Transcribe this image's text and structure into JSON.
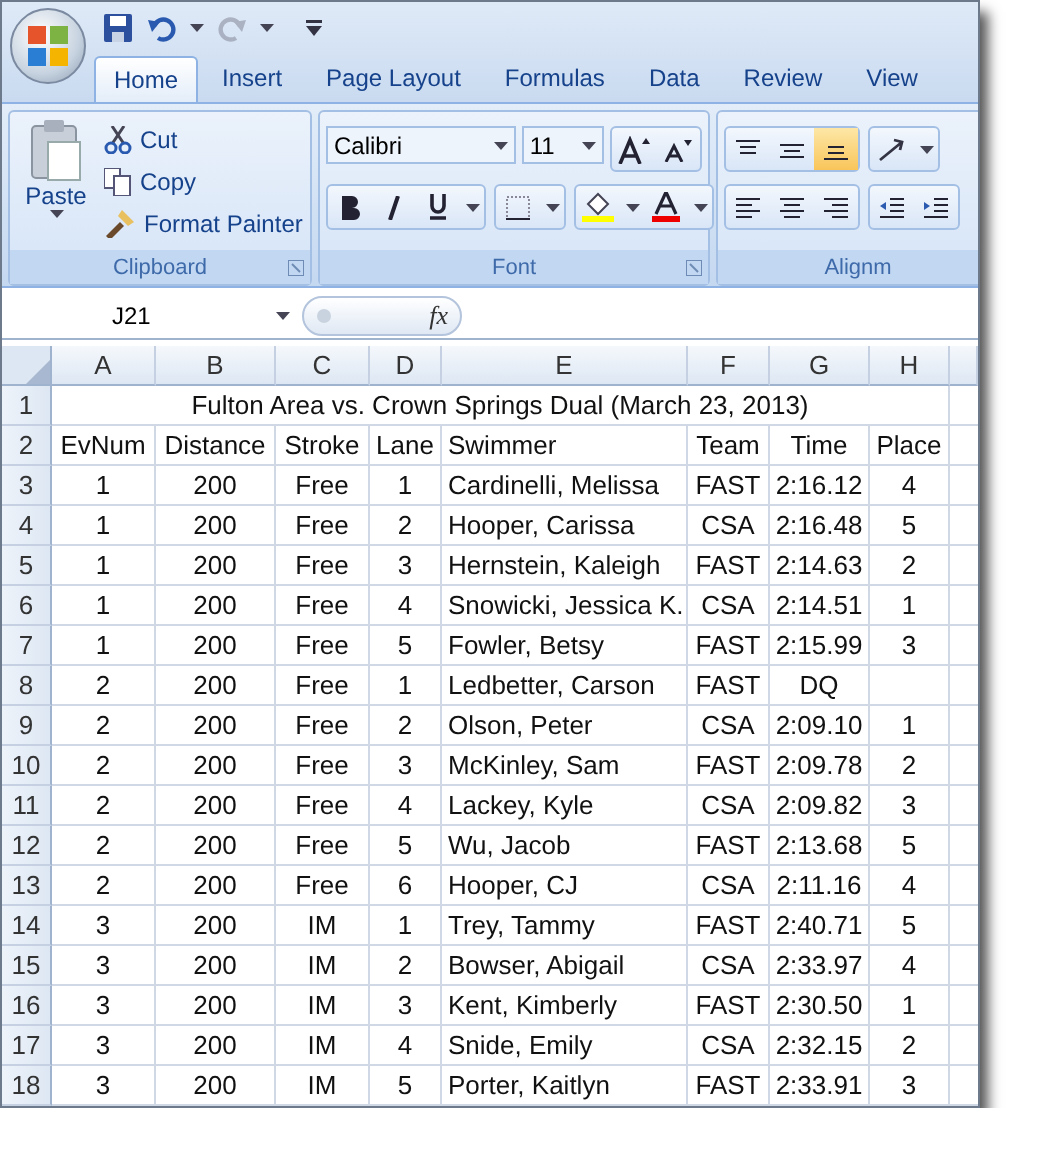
{
  "ribbon": {
    "tabs": [
      {
        "label": "Home",
        "selected": true
      },
      {
        "label": "Insert",
        "selected": false
      },
      {
        "label": "Page Layout",
        "selected": false
      },
      {
        "label": "Formulas",
        "selected": false
      },
      {
        "label": "Data",
        "selected": false
      },
      {
        "label": "Review",
        "selected": false
      },
      {
        "label": "View",
        "selected": false
      }
    ],
    "clipboard": {
      "paste": "Paste",
      "cut": "Cut",
      "copy": "Copy",
      "format_painter": "Format Painter",
      "label": "Clipboard"
    },
    "font": {
      "font_name": "Calibri",
      "font_size": "11",
      "label": "Font"
    },
    "alignment": {
      "label": "Alignm"
    }
  },
  "formula_bar": {
    "name_box": "J21",
    "fx": "fx"
  },
  "sheet": {
    "columns": [
      "A",
      "B",
      "C",
      "D",
      "E",
      "F",
      "G",
      "H"
    ],
    "title": "Fulton Area vs. Crown Springs Dual (March 23, 2013)",
    "rows": [
      {
        "number": "1",
        "cells": []
      },
      {
        "number": "2",
        "cells": [
          "EvNum",
          "Distance",
          "Stroke",
          "Lane",
          "Swimmer",
          "Team",
          "Time",
          "Place"
        ]
      },
      {
        "number": "3",
        "cells": [
          "1",
          "200",
          "Free",
          "1",
          "Cardinelli, Melissa",
          "FAST",
          "2:16.12",
          "4"
        ]
      },
      {
        "number": "4",
        "cells": [
          "1",
          "200",
          "Free",
          "2",
          "Hooper, Carissa",
          "CSA",
          "2:16.48",
          "5"
        ]
      },
      {
        "number": "5",
        "cells": [
          "1",
          "200",
          "Free",
          "3",
          "Hernstein, Kaleigh",
          "FAST",
          "2:14.63",
          "2"
        ]
      },
      {
        "number": "6",
        "cells": [
          "1",
          "200",
          "Free",
          "4",
          "Snowicki, Jessica K.",
          "CSA",
          "2:14.51",
          "1"
        ]
      },
      {
        "number": "7",
        "cells": [
          "1",
          "200",
          "Free",
          "5",
          "Fowler, Betsy",
          "FAST",
          "2:15.99",
          "3"
        ]
      },
      {
        "number": "8",
        "cells": [
          "2",
          "200",
          "Free",
          "1",
          "Ledbetter, Carson",
          "FAST",
          "DQ",
          ""
        ]
      },
      {
        "number": "9",
        "cells": [
          "2",
          "200",
          "Free",
          "2",
          "Olson, Peter",
          "CSA",
          "2:09.10",
          "1"
        ]
      },
      {
        "number": "10",
        "cells": [
          "2",
          "200",
          "Free",
          "3",
          "McKinley, Sam",
          "FAST",
          "2:09.78",
          "2"
        ]
      },
      {
        "number": "11",
        "cells": [
          "2",
          "200",
          "Free",
          "4",
          "Lackey, Kyle",
          "CSA",
          "2:09.82",
          "3"
        ]
      },
      {
        "number": "12",
        "cells": [
          "2",
          "200",
          "Free",
          "5",
          "Wu, Jacob",
          "FAST",
          "2:13.68",
          "5"
        ]
      },
      {
        "number": "13",
        "cells": [
          "2",
          "200",
          "Free",
          "6",
          "Hooper, CJ",
          "CSA",
          "2:11.16",
          "4"
        ]
      },
      {
        "number": "14",
        "cells": [
          "3",
          "200",
          "IM",
          "1",
          "Trey, Tammy",
          "FAST",
          "2:40.71",
          "5"
        ]
      },
      {
        "number": "15",
        "cells": [
          "3",
          "200",
          "IM",
          "2",
          "Bowser, Abigail",
          "CSA",
          "2:33.97",
          "4"
        ]
      },
      {
        "number": "16",
        "cells": [
          "3",
          "200",
          "IM",
          "3",
          "Kent, Kimberly",
          "FAST",
          "2:30.50",
          "1"
        ]
      },
      {
        "number": "17",
        "cells": [
          "3",
          "200",
          "IM",
          "4",
          "Snide, Emily",
          "CSA",
          "2:32.15",
          "2"
        ]
      },
      {
        "number": "18",
        "cells": [
          "3",
          "200",
          "IM",
          "5",
          "Porter, Kaitlyn",
          "FAST",
          "2:33.91",
          "3"
        ]
      }
    ]
  }
}
